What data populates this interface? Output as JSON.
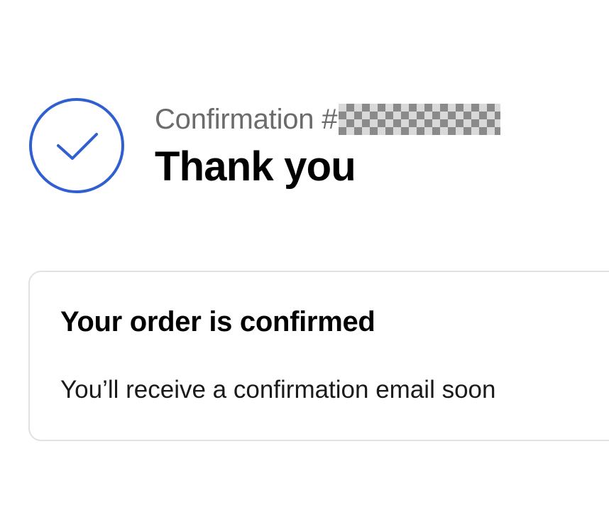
{
  "header": {
    "confirmation_label": "Confirmation #",
    "confirmation_number_redacted": true,
    "title": "Thank you"
  },
  "status_icon": {
    "name": "checkmark-circle-icon",
    "color": "#2f5fd0"
  },
  "confirmation_card": {
    "title": "Your order is confirmed",
    "body": "You’ll receive a confirmation email soon"
  }
}
